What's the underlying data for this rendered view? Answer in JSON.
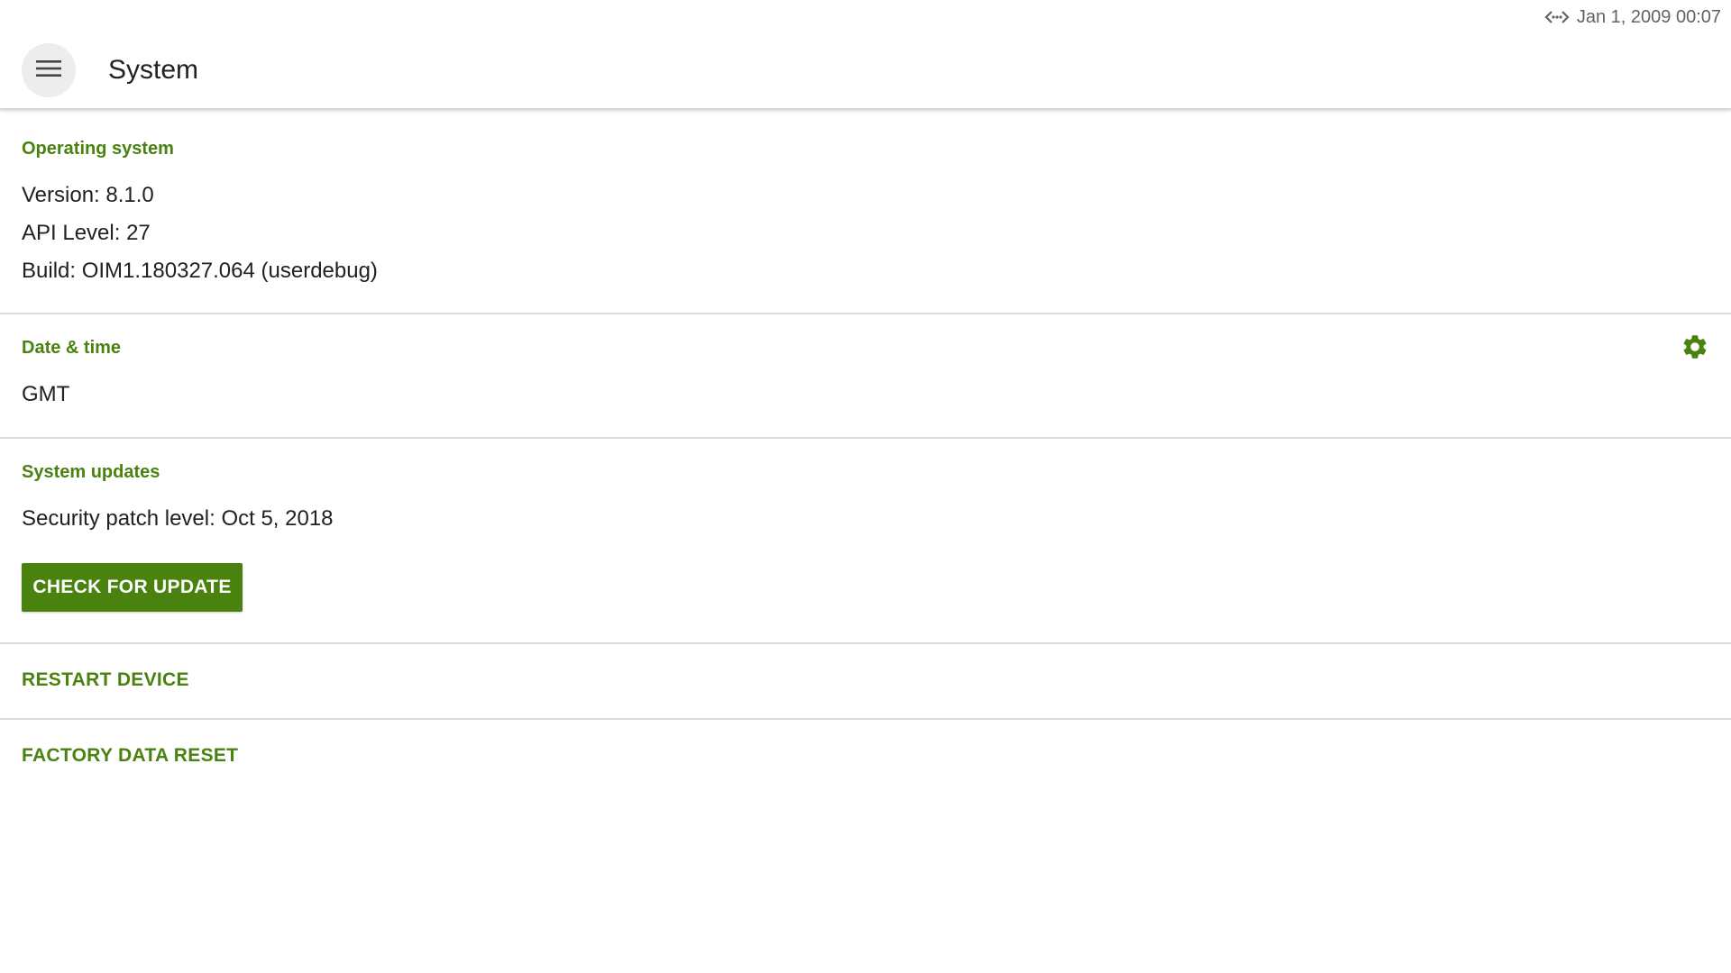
{
  "status_bar": {
    "network_icon": "ethernet-icon",
    "datetime": "Jan 1, 2009 00:07"
  },
  "app_bar": {
    "menu_icon": "menu-icon",
    "title": "System"
  },
  "operating_system": {
    "header": "Operating system",
    "version": "Version: 8.1.0",
    "api_level": "API Level: 27",
    "build": "Build: OIM1.180327.064 (userdebug)"
  },
  "date_time": {
    "header": "Date & time",
    "timezone": "GMT",
    "settings_icon": "gear-icon"
  },
  "system_updates": {
    "header": "System updates",
    "security_patch": "Security patch level: Oct 5, 2018",
    "check_button": "CHECK FOR UPDATE"
  },
  "actions": {
    "restart": "RESTART DEVICE",
    "factory_reset": "FACTORY DATA RESET"
  },
  "colors": {
    "accent": "#4a820f",
    "text": "#212121",
    "divider": "#dadada"
  }
}
